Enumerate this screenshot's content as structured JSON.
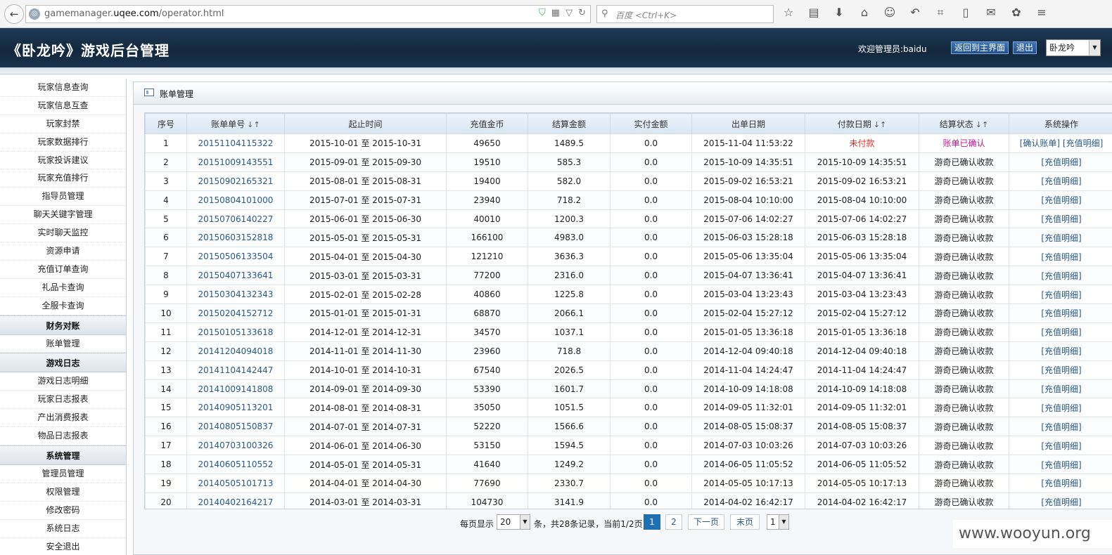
{
  "browser": {
    "url_prefix": "gamemanager.",
    "url_domain": "uqee.com",
    "url_path": "/operator.html",
    "search_placeholder": "百度 <Ctrl+K>"
  },
  "header": {
    "title": "《卧龙吟》游戏后台管理",
    "welcome": "欢迎管理员:baidu",
    "home_button": "返回到主界面",
    "logout_button": "退出",
    "game_select": "卧龙吟"
  },
  "sidebar": {
    "items_top": [
      "玩家信息查询",
      "玩家信息互查",
      "玩家封禁",
      "玩家数据排行",
      "玩家投诉建议",
      "玩家充值排行",
      "指导员管理",
      "聊天关键字管理",
      "实时聊天监控",
      "资源申请",
      "充值订单查询",
      "礼品卡查询",
      "全服卡查询"
    ],
    "section_finance": "财务对账",
    "items_finance": [
      "账单管理"
    ],
    "section_log": "游戏日志",
    "items_log": [
      "游戏日志明细",
      "玩家日志报表",
      "产出消费报表",
      "物品日志报表"
    ],
    "section_system": "系统管理",
    "items_system": [
      "管理员管理",
      "权限管理",
      "修改密码",
      "系统日志",
      "安全退出"
    ]
  },
  "panel": {
    "title": "账单管理"
  },
  "table": {
    "columns": [
      "序号",
      "账单单号",
      "起止时间",
      "充值金币",
      "结算金额",
      "实付金额",
      "出单日期",
      "付款日期",
      "结算状态",
      "系统操作"
    ],
    "sort_icon": "↓↑",
    "rows": [
      [
        "1",
        "20151104115322",
        "2015-10-01 至 2015-10-31",
        "49650",
        "1489.5",
        "0.0",
        "2015-11-04 11:53:22",
        "未付款",
        "账单已确认",
        "[确认账单] [充值明细]"
      ],
      [
        "2",
        "20151009143551",
        "2015-09-01 至 2015-09-30",
        "19510",
        "585.3",
        "0.0",
        "2015-10-09 14:35:51",
        "2015-10-09 14:35:51",
        "游奇已确认收款",
        "[充值明细]"
      ],
      [
        "3",
        "20150902165321",
        "2015-08-01 至 2015-08-31",
        "19400",
        "582.0",
        "0.0",
        "2015-09-02 16:53:21",
        "2015-09-02 16:53:21",
        "游奇已确认收款",
        "[充值明细]"
      ],
      [
        "4",
        "20150804101000",
        "2015-07-01 至 2015-07-31",
        "23940",
        "718.2",
        "0.0",
        "2015-08-04 10:10:00",
        "2015-08-04 10:10:00",
        "游奇已确认收款",
        "[充值明细]"
      ],
      [
        "5",
        "20150706140227",
        "2015-06-01 至 2015-06-30",
        "40010",
        "1200.3",
        "0.0",
        "2015-07-06 14:02:27",
        "2015-07-06 14:02:27",
        "游奇已确认收款",
        "[充值明细]"
      ],
      [
        "6",
        "20150603152818",
        "2015-05-01 至 2015-05-31",
        "166100",
        "4983.0",
        "0.0",
        "2015-06-03 15:28:18",
        "2015-06-03 15:28:18",
        "游奇已确认收款",
        "[充值明细]"
      ],
      [
        "7",
        "20150506133504",
        "2015-04-01 至 2015-04-30",
        "121210",
        "3636.3",
        "0.0",
        "2015-05-06 13:35:04",
        "2015-05-06 13:35:04",
        "游奇已确认收款",
        "[充值明细]"
      ],
      [
        "8",
        "20150407133641",
        "2015-03-01 至 2015-03-31",
        "77200",
        "2316.0",
        "0.0",
        "2015-04-07 13:36:41",
        "2015-04-07 13:36:41",
        "游奇已确认收款",
        "[充值明细]"
      ],
      [
        "9",
        "20150304132343",
        "2015-02-01 至 2015-02-28",
        "40860",
        "1225.8",
        "0.0",
        "2015-03-04 13:23:43",
        "2015-03-04 13:23:43",
        "游奇已确认收款",
        "[充值明细]"
      ],
      [
        "10",
        "20150204152712",
        "2015-01-01 至 2015-01-31",
        "68870",
        "2066.1",
        "0.0",
        "2015-02-04 15:27:12",
        "2015-02-04 15:27:12",
        "游奇已确认收款",
        "[充值明细]"
      ],
      [
        "11",
        "20150105133618",
        "2014-12-01 至 2014-12-31",
        "34570",
        "1037.1",
        "0.0",
        "2015-01-05 13:36:18",
        "2015-01-05 13:36:18",
        "游奇已确认收款",
        "[充值明细]"
      ],
      [
        "12",
        "20141204094018",
        "2014-11-01 至 2014-11-30",
        "23960",
        "718.8",
        "0.0",
        "2014-12-04 09:40:18",
        "2014-12-04 09:40:18",
        "游奇已确认收款",
        "[充值明细]"
      ],
      [
        "13",
        "20141104142447",
        "2014-10-01 至 2014-10-31",
        "67540",
        "2026.5",
        "0.0",
        "2014-11-04 14:24:47",
        "2014-11-04 14:24:47",
        "游奇已确认收款",
        "[充值明细]"
      ],
      [
        "14",
        "20141009141808",
        "2014-09-01 至 2014-09-30",
        "53390",
        "1601.7",
        "0.0",
        "2014-10-09 14:18:08",
        "2014-10-09 14:18:08",
        "游奇已确认收款",
        "[充值明细]"
      ],
      [
        "15",
        "20140905113201",
        "2014-08-01 至 2014-08-31",
        "35050",
        "1051.5",
        "0.0",
        "2014-09-05 11:32:01",
        "2014-09-05 11:32:01",
        "游奇已确认收款",
        "[充值明细]"
      ],
      [
        "16",
        "20140805150837",
        "2014-07-01 至 2014-07-31",
        "52220",
        "1566.6",
        "0.0",
        "2014-08-05 15:08:37",
        "2014-08-05 15:08:37",
        "游奇已确认收款",
        "[充值明细]"
      ],
      [
        "17",
        "20140703100326",
        "2014-06-01 至 2014-06-30",
        "53150",
        "1594.5",
        "0.0",
        "2014-07-03 10:03:26",
        "2014-07-03 10:03:26",
        "游奇已确认收款",
        "[充值明细]"
      ],
      [
        "18",
        "20140605110552",
        "2014-05-01 至 2014-05-31",
        "41640",
        "1249.2",
        "0.0",
        "2014-06-05 11:05:52",
        "2014-06-05 11:05:52",
        "游奇已确认收款",
        "[充值明细]"
      ],
      [
        "19",
        "20140505101713",
        "2014-04-01 至 2014-04-30",
        "77690",
        "2330.7",
        "0.0",
        "2014-05-05 10:17:13",
        "2014-05-05 10:17:13",
        "游奇已确认收款",
        "[充值明细]"
      ],
      [
        "20",
        "20140402164217",
        "2014-03-01 至 2014-03-31",
        "104730",
        "3141.9",
        "0.0",
        "2014-04-02 16:42:17",
        "2014-04-02 16:42:17",
        "游奇已确认收款",
        "[充值明细]"
      ]
    ]
  },
  "pager": {
    "per_page_label": "每页显示",
    "per_page_value": "20",
    "summary": "条，共28条记录，当前1/2页",
    "page1": "1",
    "page2": "2",
    "next": "下一页",
    "last": "末页",
    "jump_value": "1"
  },
  "watermark": "www.wooyun.org",
  "colors": {
    "header_bg": "#1a3450",
    "link": "#2a5a88",
    "unpaid": "#e03030",
    "confirmed": "#c0189a",
    "current_page": "#1f6fb5"
  }
}
